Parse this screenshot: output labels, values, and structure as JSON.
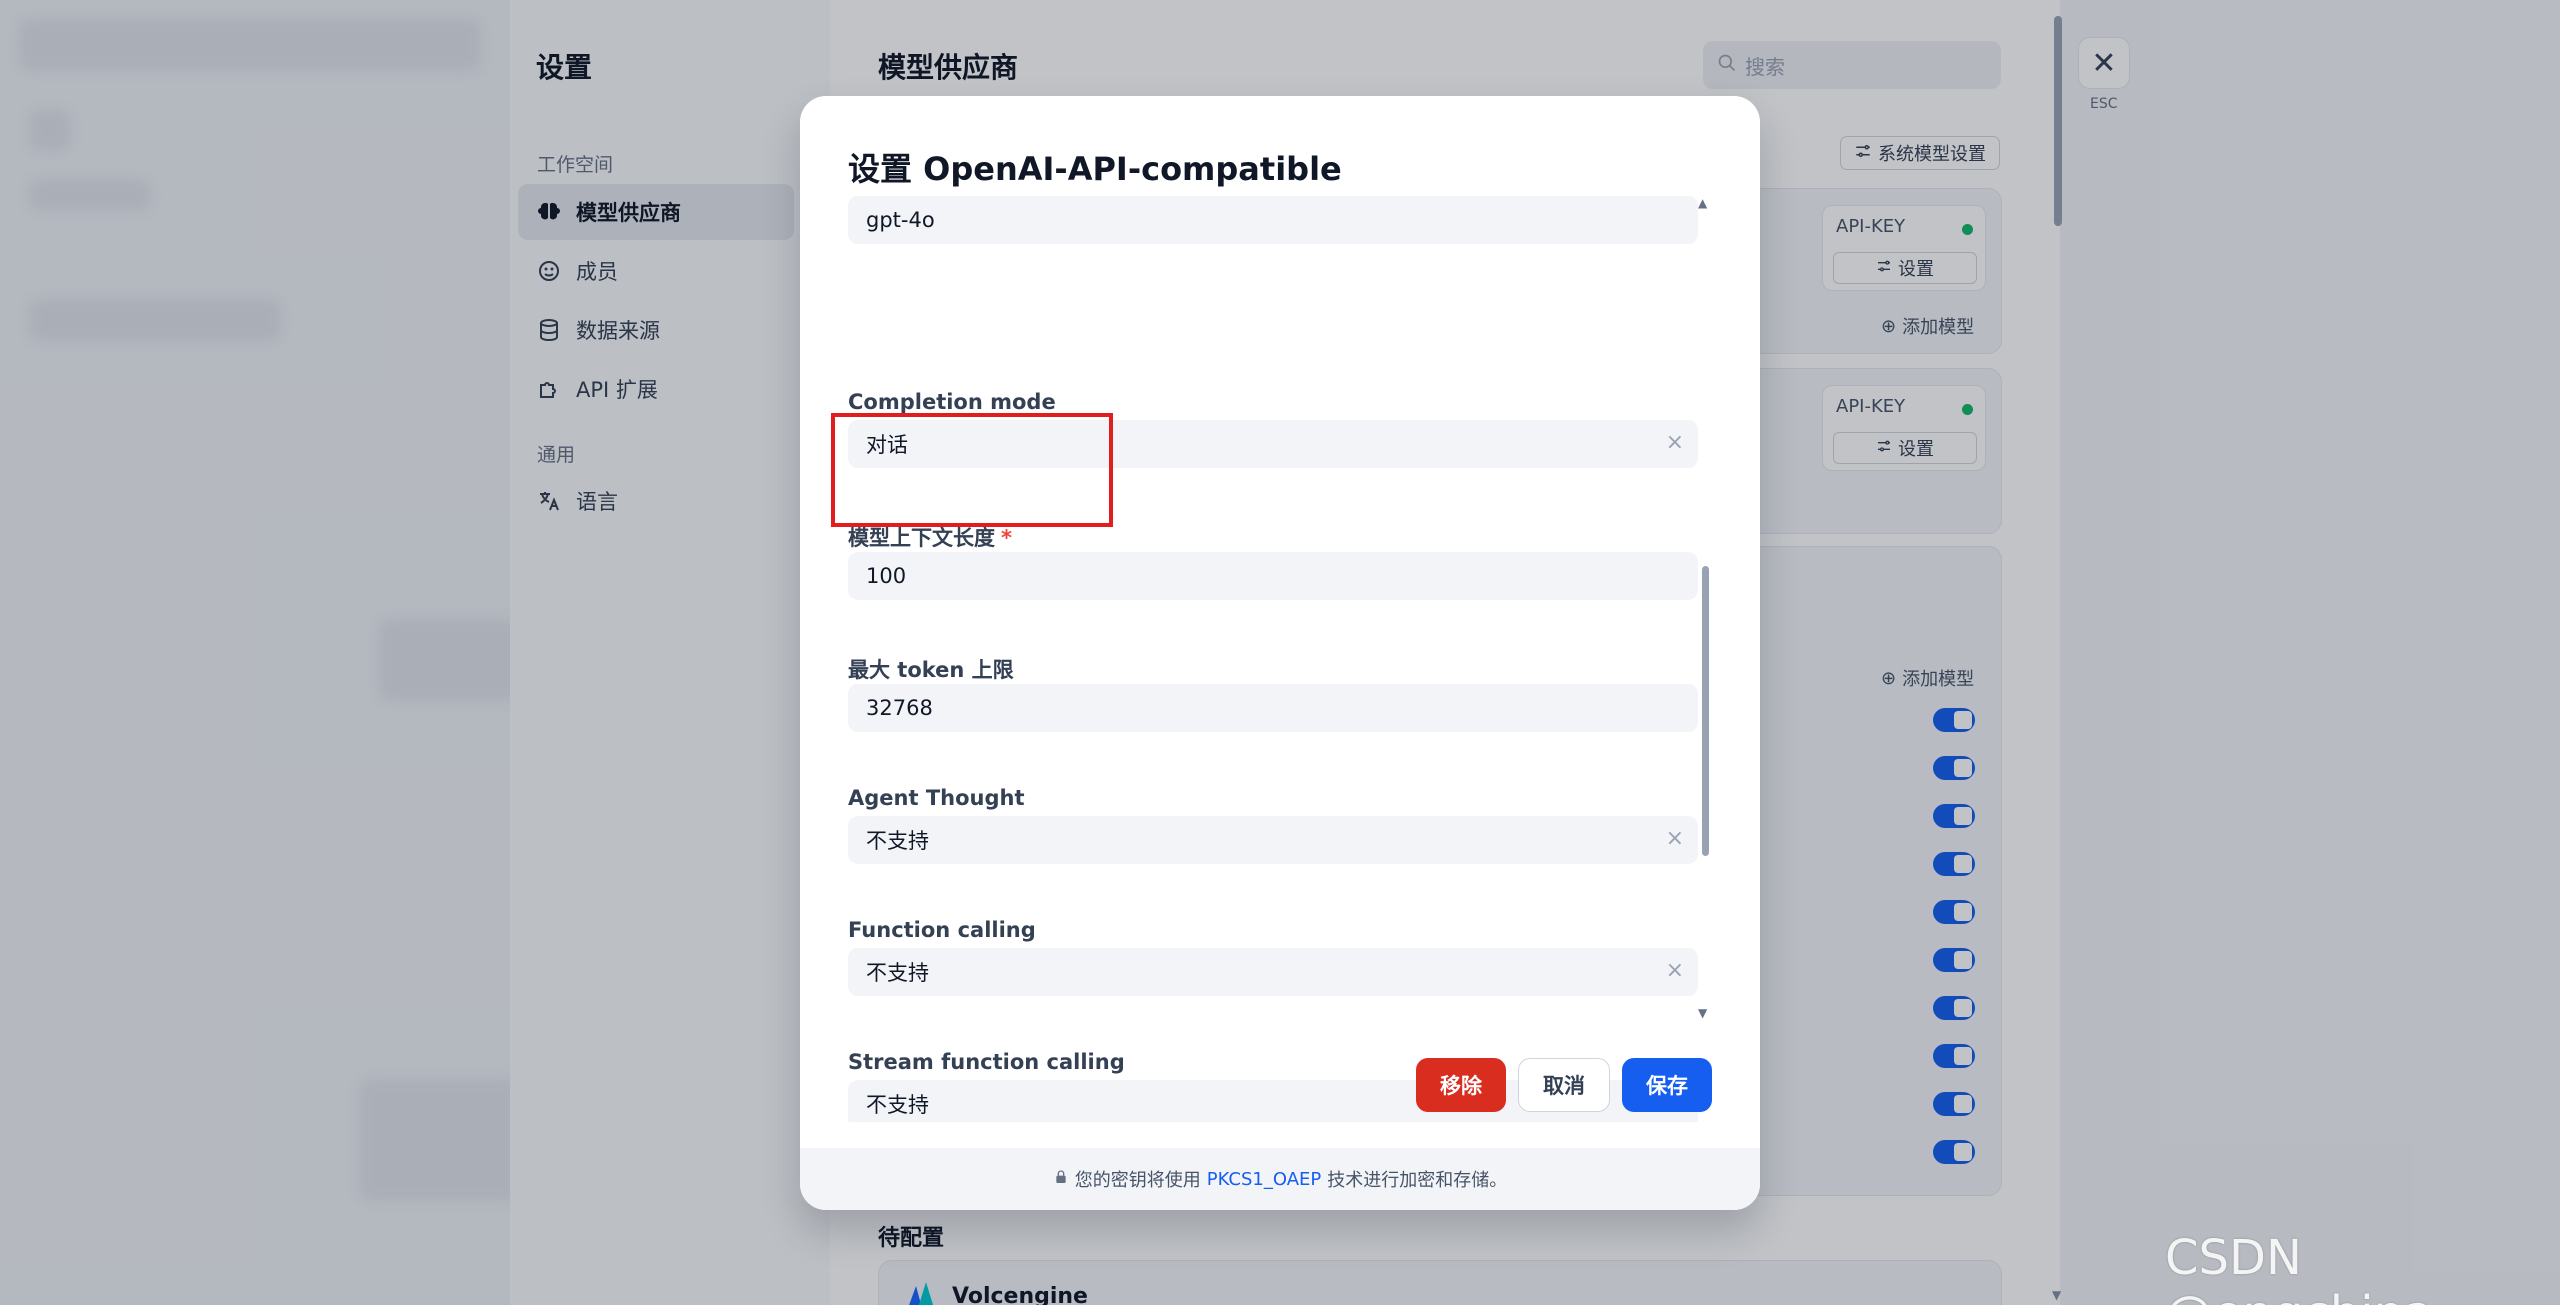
{
  "settings": {
    "title": "设置",
    "group_workspace": "工作空间",
    "group_general": "通用",
    "nav": [
      {
        "label": "模型供应商",
        "icon": "brain-icon",
        "active": true
      },
      {
        "label": "成员",
        "icon": "members-icon"
      },
      {
        "label": "数据来源",
        "icon": "database-icon"
      },
      {
        "label": "API 扩展",
        "icon": "puzzle-icon"
      },
      {
        "label": "语言",
        "icon": "translate-icon"
      }
    ]
  },
  "main": {
    "title": "模型供应商",
    "search_placeholder": "搜索",
    "system_model_settings": "系统模型设置",
    "apikey_label": "API-KEY",
    "apikey_settings": "设置",
    "add_model": "添加模型",
    "pending_title": "待配置",
    "volcengine_name": "Volcengine",
    "close_label": "ESC",
    "close_glyph": "✕"
  },
  "modal": {
    "title": "设置 OpenAI-API-compatible",
    "fields": [
      {
        "label": "",
        "value": "gpt-4o",
        "clearable": false
      },
      {
        "label": "Completion mode",
        "value": "对话",
        "clearable": true
      },
      {
        "label": "模型上下文长度",
        "value": "100",
        "required": true
      },
      {
        "label": "最大 token 上限",
        "value": "32768"
      },
      {
        "label": "Agent Thought",
        "value": "不支持",
        "clearable": true
      },
      {
        "label": "Function calling",
        "value": "不支持",
        "clearable": true
      },
      {
        "label": "Stream function calling",
        "value": "不支持",
        "clearable": true
      }
    ],
    "required_mark": "*",
    "clear_glyph": "×",
    "buttons": {
      "remove": "移除",
      "cancel": "取消",
      "save": "保存"
    },
    "footer": {
      "text_before": "您的密钥将使用",
      "link": "PKCS1_OAEP",
      "text_after": "技术进行加密和存储。"
    }
  },
  "watermark": "CSDN @engchina",
  "colors": {
    "primary": "#155eef",
    "danger": "#d92d20",
    "highlight": "#e11d1d",
    "status_ok": "#12b76a"
  }
}
